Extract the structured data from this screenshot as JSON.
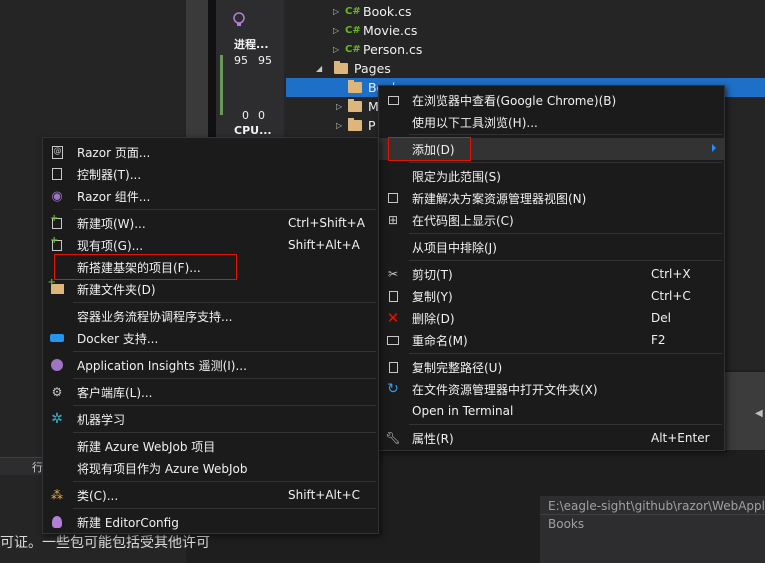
{
  "diagnostics": {
    "process_label": "进程...",
    "process_values": [
      "95",
      "95"
    ],
    "cpu_label": "CPU...",
    "cpu_values": [
      "0",
      "0"
    ]
  },
  "solution_explorer": {
    "items": [
      {
        "name": "Book.cs",
        "type": "cs"
      },
      {
        "name": "Movie.cs",
        "type": "cs"
      },
      {
        "name": "Person.cs",
        "type": "cs"
      },
      {
        "name": "Pages",
        "type": "folder"
      },
      {
        "name": "Book",
        "type": "folder"
      },
      {
        "name": "M",
        "type": "folder"
      },
      {
        "name": "P",
        "type": "folder"
      }
    ]
  },
  "cs_badge": "C#",
  "bottom": {
    "tab_text": "行",
    "license_text": "可证。一些包可能包括受其他许可",
    "path": "E:\\eagle-sight\\github\\razor\\WebAppl",
    "name_value": "Books"
  },
  "context_menu": {
    "items": [
      {
        "label": "在浏览器中查看(Google Chrome)(B)",
        "shortcut": "",
        "icon": "browser-icon"
      },
      {
        "label": "使用以下工具浏览(H)...",
        "shortcut": "",
        "icon": ""
      },
      {
        "label": "添加(D)",
        "shortcut": "",
        "icon": "",
        "submenu": true
      },
      {
        "label": "限定为此范围(S)",
        "shortcut": "",
        "icon": ""
      },
      {
        "label": "新建解决方案资源管理器视图(N)",
        "shortcut": "",
        "icon": "solution-view-icon"
      },
      {
        "label": "在代码图上显示(C)",
        "shortcut": "",
        "icon": "code-map-icon"
      },
      {
        "label": "从项目中排除(J)",
        "shortcut": "",
        "icon": ""
      },
      {
        "label": "剪切(T)",
        "shortcut": "Ctrl+X",
        "icon": "cut-icon"
      },
      {
        "label": "复制(Y)",
        "shortcut": "Ctrl+C",
        "icon": "copy-icon"
      },
      {
        "label": "删除(D)",
        "shortcut": "Del",
        "icon": "delete-icon"
      },
      {
        "label": "重命名(M)",
        "shortcut": "F2",
        "icon": "rename-icon"
      },
      {
        "label": "复制完整路径(U)",
        "shortcut": "",
        "icon": "copy-path-icon"
      },
      {
        "label": "在文件资源管理器中打开文件夹(X)",
        "shortcut": "",
        "icon": "refresh-icon"
      },
      {
        "label": "Open in Terminal",
        "shortcut": "",
        "icon": ""
      },
      {
        "label": "属性(R)",
        "shortcut": "Alt+Enter",
        "icon": "wrench-icon"
      }
    ]
  },
  "add_submenu": {
    "items": [
      {
        "label": "Razor 页面...",
        "shortcut": "",
        "icon": "razor-page-icon"
      },
      {
        "label": "控制器(T)...",
        "shortcut": "",
        "icon": "controller-icon"
      },
      {
        "label": "Razor 组件...",
        "shortcut": "",
        "icon": "razor-component-icon"
      },
      {
        "label": "新建项(W)...",
        "shortcut": "Ctrl+Shift+A",
        "icon": "new-item-icon"
      },
      {
        "label": "现有项(G)...",
        "shortcut": "Shift+Alt+A",
        "icon": "existing-item-icon"
      },
      {
        "label": "新搭建基架的项目(F)...",
        "shortcut": "",
        "icon": ""
      },
      {
        "label": "新建文件夹(D)",
        "shortcut": "",
        "icon": "new-folder-icon"
      },
      {
        "label": "容器业务流程协调程序支持...",
        "shortcut": "",
        "icon": ""
      },
      {
        "label": "Docker 支持...",
        "shortcut": "",
        "icon": "docker-icon"
      },
      {
        "label": "Application Insights 遥测(I)...",
        "shortcut": "",
        "icon": "insights-icon"
      },
      {
        "label": "客户端库(L)...",
        "shortcut": "",
        "icon": "library-icon"
      },
      {
        "label": "机器学习",
        "shortcut": "",
        "icon": "ml-gear-icon"
      },
      {
        "label": "新建 Azure WebJob 项目",
        "shortcut": "",
        "icon": ""
      },
      {
        "label": "将现有项目作为 Azure WebJob",
        "shortcut": "",
        "icon": ""
      },
      {
        "label": "类(C)...",
        "shortcut": "Shift+Alt+C",
        "icon": "class-icon"
      },
      {
        "label": "新建 EditorConfig",
        "shortcut": "",
        "icon": "editorconfig-icon"
      }
    ]
  }
}
